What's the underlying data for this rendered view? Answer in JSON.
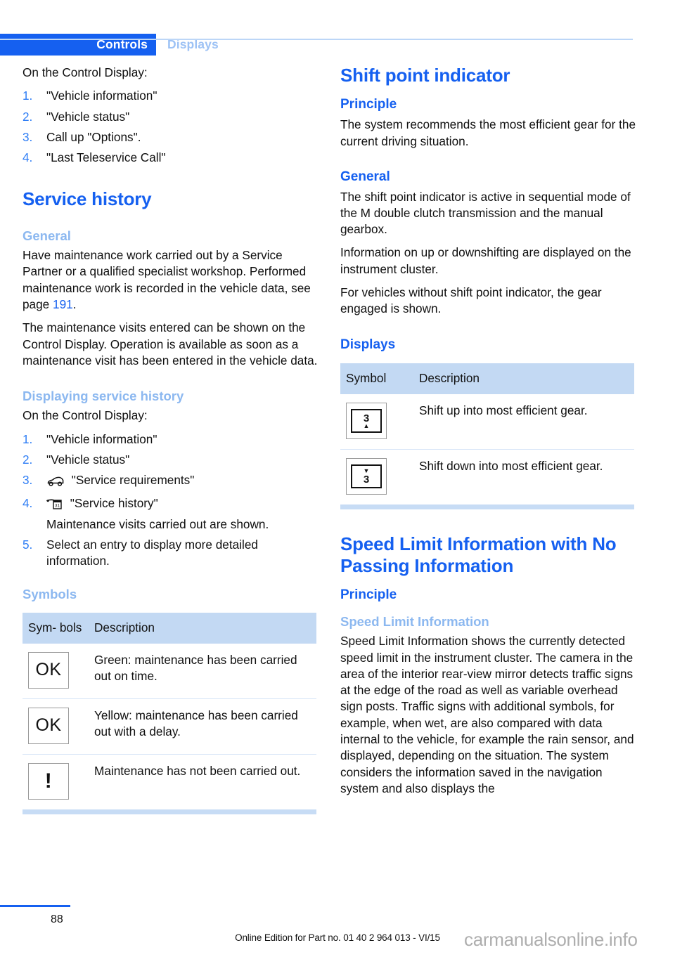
{
  "header": {
    "active_tab": "Controls",
    "inactive_tab": "Displays",
    "accent_color": "#1560f0",
    "light_accent_color": "#8cb8f0"
  },
  "left_column": {
    "intro_lead": "On the Control Display:",
    "intro_steps": [
      {
        "num": "1.",
        "text": "\"Vehicle information\""
      },
      {
        "num": "2.",
        "text": "\"Vehicle status\""
      },
      {
        "num": "3.",
        "text": "Call up \"Options\"."
      },
      {
        "num": "4.",
        "text": "\"Last Teleservice Call\""
      }
    ],
    "section_title": "Service history",
    "general_heading": "General",
    "general_p1_a": "Have maintenance work carried out by a Service Partner or a qualified specialist workshop. Performed maintenance work is recorded in the vehicle data, see page ",
    "general_p1_ref": "191",
    "general_p1_b": ".",
    "general_p2": "The maintenance visits entered can be shown on the Control Display. Operation is available as soon as a maintenance visit has been entered in the vehicle data.",
    "displaying_heading": "Displaying service history",
    "displaying_lead": "On the Control Display:",
    "displaying_steps": [
      {
        "num": "1.",
        "text": "\"Vehicle information\"",
        "icon": ""
      },
      {
        "num": "2.",
        "text": "\"Vehicle status\"",
        "icon": ""
      },
      {
        "num": "3.",
        "text": "\"Service requirements\"",
        "icon": "car-silhouette-icon"
      },
      {
        "num": "4.",
        "text": "\"Service history\"",
        "icon": "service-calendar-icon",
        "sub": "Maintenance visits carried out are shown."
      },
      {
        "num": "5.",
        "text": "Select an entry to display more detailed information.",
        "icon": ""
      }
    ],
    "symbols_heading": "Symbols",
    "symbols_table": {
      "columns": [
        "Sym-bols",
        "Description"
      ],
      "col_symbol_header": "Sym- bols",
      "col_desc_header": "Description",
      "rows": [
        {
          "symbol": "OK",
          "symbol_name": "ok-box-green-icon",
          "description": "Green: maintenance has been carried out on time."
        },
        {
          "symbol": "OK",
          "symbol_name": "ok-box-yellow-icon",
          "description": "Yellow: maintenance has been carried out with a delay."
        },
        {
          "symbol": "!",
          "symbol_name": "exclamation-box-icon",
          "description": "Maintenance has not been carried out."
        }
      ]
    }
  },
  "right_column": {
    "section1_title": "Shift point indicator",
    "principle_heading": "Principle",
    "principle_text": "The system recommends the most efficient gear for the current driving situation.",
    "general_heading": "General",
    "general_p1": "The shift point indicator is active in sequential mode of the M double clutch transmission and the manual gearbox.",
    "general_p2": "Information on up or downshifting are displayed on the instrument cluster.",
    "general_p3": "For vehicles without shift point indicator, the gear engaged is shown.",
    "displays_heading": "Displays",
    "displays_table": {
      "col_symbol_header": "Symbol",
      "col_desc_header": "Description",
      "rows": [
        {
          "gear": "3",
          "arrow": "▲",
          "arrow_position": "below",
          "symbol_name": "shift-up-gear-3-icon",
          "description": "Shift up into most efficient gear."
        },
        {
          "gear": "3",
          "arrow": "▼",
          "arrow_position": "above",
          "symbol_name": "shift-down-gear-3-icon",
          "description": "Shift down into most efficient gear."
        }
      ]
    },
    "section2_title": "Speed Limit Information with No Passing Information",
    "section2_principle_heading": "Principle",
    "section2_subsub_heading": "Speed Limit Information",
    "section2_text": "Speed Limit Information shows the currently detected speed limit in the instrument cluster. The camera in the area of the interior rear-view mirror detects traffic signs at the edge of the road as well as variable overhead sign posts. Traffic signs with additional symbols, for example, when wet, are also compared with data internal to the vehicle, for example the rain sensor, and displayed, depending on the situation. The system considers the information saved in the navigation system and also displays the"
  },
  "footer": {
    "page_number": "88",
    "edition_text": "Online Edition for Part no. 01 40 2 964 013 - VI/15",
    "watermark": "carmanualsonline.info"
  }
}
